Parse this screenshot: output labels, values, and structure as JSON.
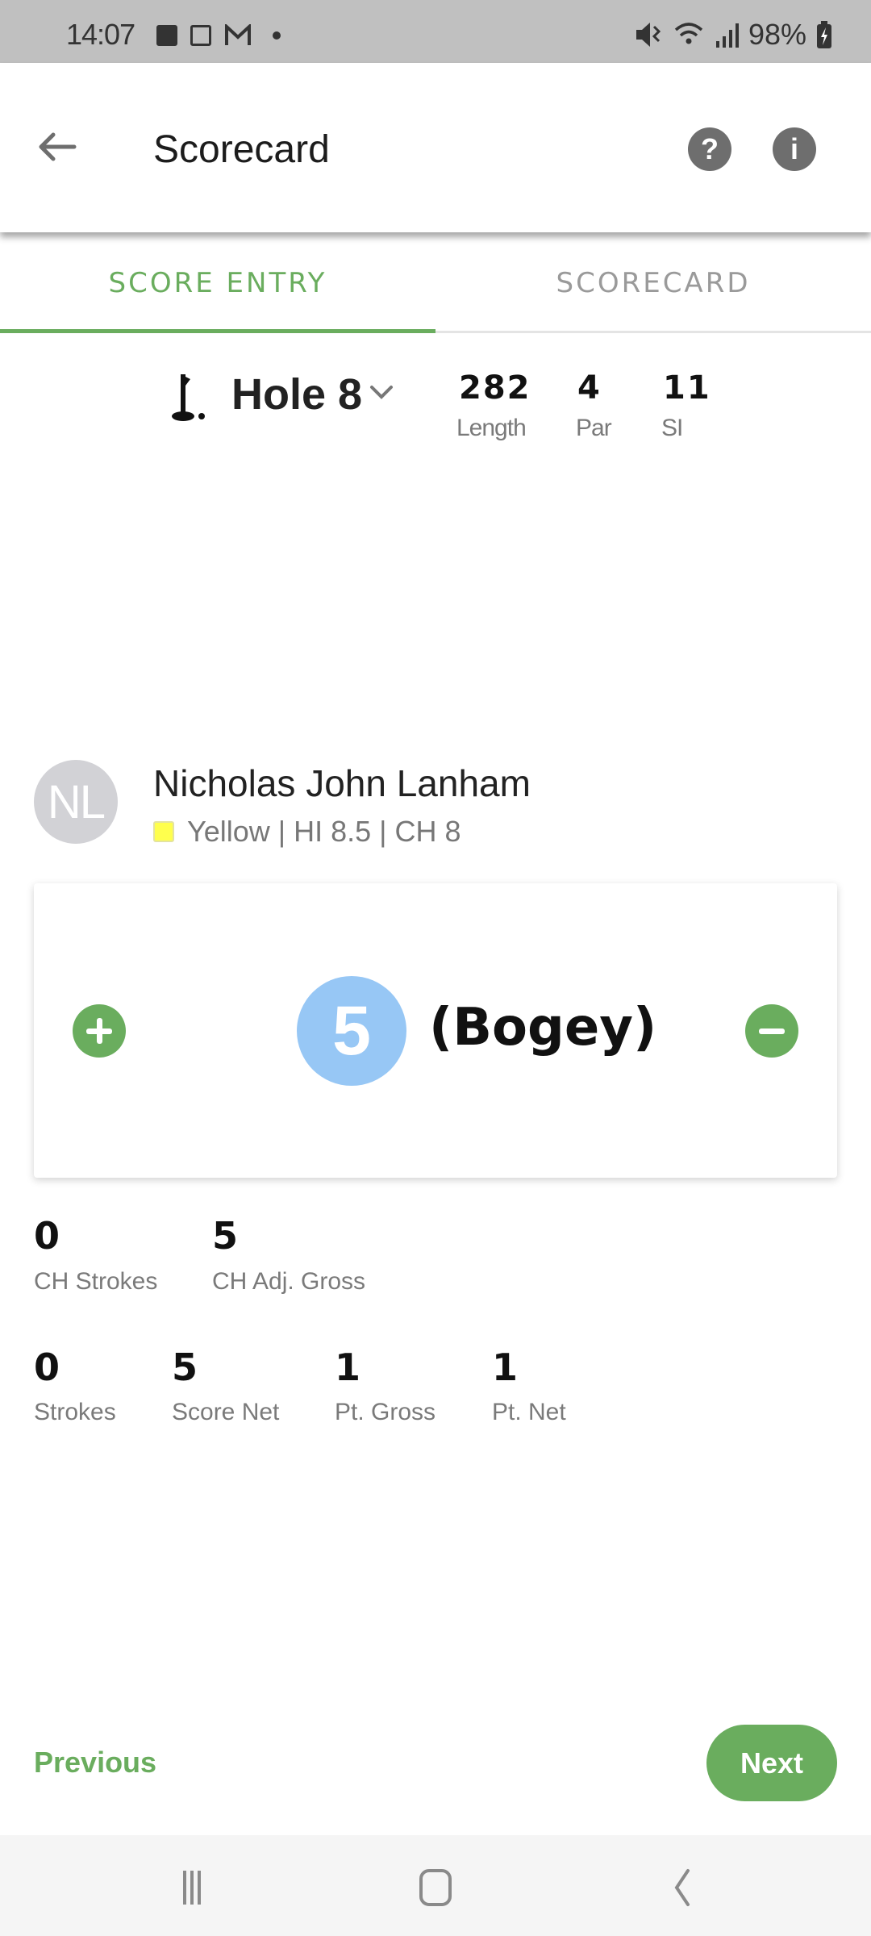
{
  "status_bar": {
    "time": "14:07",
    "left_icons": [
      "gallery-icon",
      "calendar-icon",
      "gmail-icon",
      "notification-dot-icon"
    ],
    "right_icons": [
      "mute-icon",
      "wifi-icon",
      "signal-icon",
      "battery-charging-icon"
    ],
    "battery": "98%"
  },
  "app_bar": {
    "title": "Scorecard",
    "back_icon": "arrow-left-icon",
    "actions": [
      {
        "name": "help",
        "icon": "question-circle-icon",
        "glyph": "?"
      },
      {
        "name": "info",
        "icon": "info-circle-icon",
        "glyph": "i"
      }
    ]
  },
  "tabs": [
    {
      "label": "SCORE ENTRY",
      "active": true
    },
    {
      "label": "SCORECARD",
      "active": false
    }
  ],
  "hole": {
    "title": "Hole 8",
    "stats": [
      {
        "value": "282",
        "label": "Length"
      },
      {
        "value": "4",
        "label": "Par"
      },
      {
        "value": "11",
        "label": "SI"
      }
    ]
  },
  "player": {
    "initials": "NL",
    "name": "Nicholas John Lanham",
    "tee_color": "#ffff4d",
    "subtitle": "Yellow | HI 8.5 | CH 8"
  },
  "score_entry": {
    "score": "5",
    "score_name": "(Bogey)",
    "score_circle_color": "#97c7f5"
  },
  "stats_row1": [
    {
      "value": "0",
      "label": "CH Strokes"
    },
    {
      "value": "5",
      "label": "CH Adj. Gross"
    }
  ],
  "stats_row2": [
    {
      "value": "0",
      "label": "Strokes"
    },
    {
      "value": "5",
      "label": "Score Net"
    },
    {
      "value": "1",
      "label": "Pt. Gross"
    },
    {
      "value": "1",
      "label": "Pt. Net"
    }
  ],
  "footer": {
    "previous_label": "Previous",
    "next_label": "Next"
  },
  "colors": {
    "accent": "#6aad5e",
    "inactive_tab": "#9a9a9a",
    "status_bar": "#c0c0c0"
  },
  "nav_bar": [
    "recent-apps-icon",
    "home-icon",
    "back-icon"
  ]
}
